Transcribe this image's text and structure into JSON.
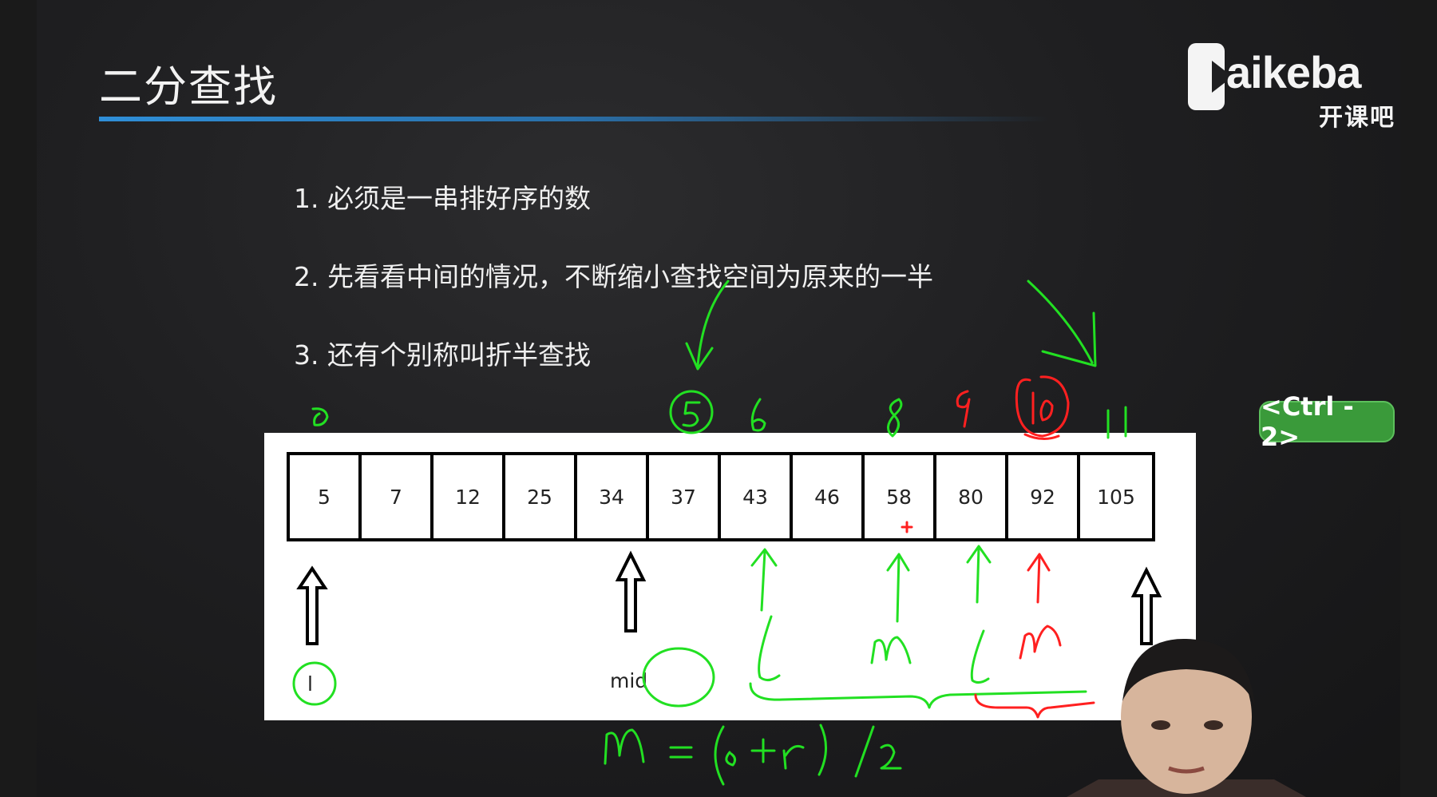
{
  "slide": {
    "title": "二分查找",
    "logo_word": "aikeba",
    "logo_sub": "开课吧",
    "bullets": [
      "1. 必须是一串排好序的数",
      "2. 先看看中间的情况，不断缩小查找空间为原来的一半",
      "3. 还有个别称叫折半查找"
    ],
    "shortcut_badge": "<Ctrl - 2>"
  },
  "diagram": {
    "array_values": [
      "5",
      "7",
      "12",
      "25",
      "34",
      "37",
      "43",
      "46",
      "58",
      "80",
      "92",
      "105"
    ],
    "pointer_left_label": "l",
    "pointer_mid_label": "mid"
  },
  "colors": {
    "ink_green": "#22e022",
    "ink_red": "#ff2020",
    "badge_green": "#3a9a3a",
    "title_rule": "#2f8fd8"
  }
}
